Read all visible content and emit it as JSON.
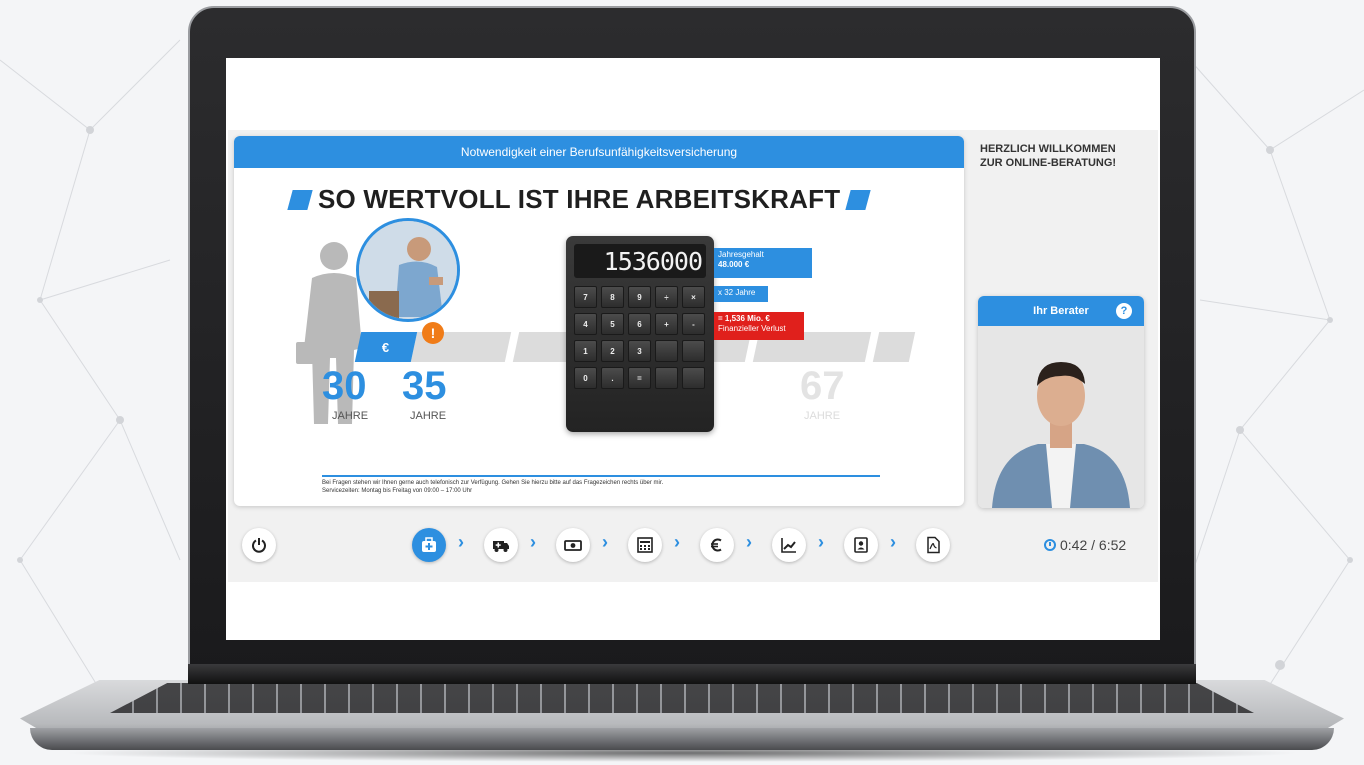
{
  "app": {
    "header_title": "Notwendigkeit einer Berufsunfähigkeitsversicherung",
    "slide_title": "SO WERTVOLL IST IHRE ARBEITSKRAFT",
    "welcome_line1": "HERZLICH WILLKOMMEN",
    "welcome_line2": "ZUR ONLINE-BERATUNG!"
  },
  "timeline": {
    "age_start": "30",
    "age_event": "35",
    "age_end": "67",
    "unit_label": "JAHRE"
  },
  "calculator": {
    "display": "1536000",
    "keys": [
      "7",
      "8",
      "9",
      "÷",
      "×",
      "4",
      "5",
      "6",
      "+",
      "-",
      "1",
      "2",
      "3",
      "",
      "",
      "0",
      ".",
      "=",
      "",
      ""
    ],
    "salary_label": "Jahresgehalt",
    "salary_value": "48.000 €",
    "multiplier": "x 32 Jahre",
    "loss_value": "= 1,536 Mio. €",
    "loss_label": "Finanzieller Verlust"
  },
  "footer": {
    "line1": "Bei Fragen stehen wir Ihnen gerne auch telefonisch zur Verfügung. Gehen Sie hierzu bitte auf das Fragezeichen rechts über mir.",
    "line2": "Servicezeiten: Montag bis Freitag von 09:00 – 17:00 Uhr"
  },
  "advisor": {
    "title": "Ihr Berater",
    "help_glyph": "?"
  },
  "nav": {
    "steps": [
      {
        "icon": "medical-kit-icon",
        "active": true
      },
      {
        "icon": "ambulance-icon",
        "active": false
      },
      {
        "icon": "banknote-icon",
        "active": false
      },
      {
        "icon": "calculator-icon",
        "active": false
      },
      {
        "icon": "euro-icon",
        "active": false
      },
      {
        "icon": "line-chart-icon",
        "active": false
      },
      {
        "icon": "contact-card-icon",
        "active": false
      },
      {
        "icon": "pdf-icon",
        "active": false
      }
    ],
    "timer": "0:42 / 6:52"
  },
  "colors": {
    "accent": "#2d8fe0",
    "warning": "#f07c18",
    "loss": "#e0201c"
  }
}
